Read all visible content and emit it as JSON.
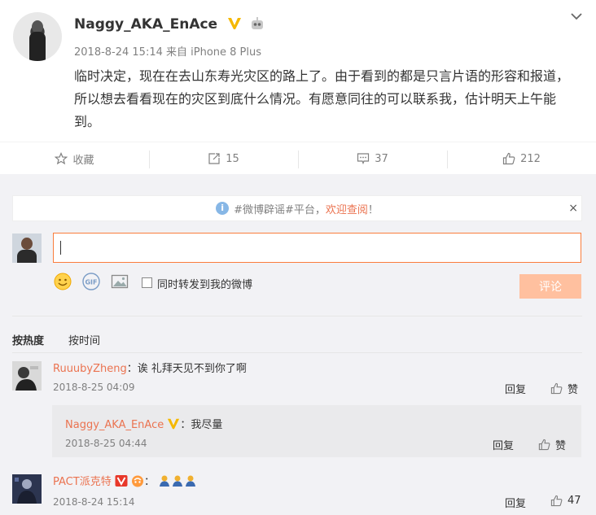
{
  "post": {
    "author": "Naggy_AKA_EnAce",
    "meta": "2018-8-24 15:14 来自 iPhone 8 Plus",
    "text": "临时决定，现在在去山东寿光灾区的路上了。由于看到的都是只言片语的形容和报道，所以想去看看现在的灾区到底什么情况。有愿意同往的可以联系我，估计明天上午能到。"
  },
  "actions": {
    "favorite": "收藏",
    "repost_count": "15",
    "comment_count": "37",
    "like_count": "212"
  },
  "notice": {
    "prefix": "#微博辟谣#平台，",
    "link": "欢迎查阅",
    "suffix": "！",
    "close": "×"
  },
  "composer": {
    "value": "",
    "repost_label": "同时转发到我的微博",
    "submit_label": "评论"
  },
  "sort": {
    "hot": "按热度",
    "time": "按时间"
  },
  "comments": [
    {
      "user": "RuuubyZheng",
      "text": "：诶 礼拜天见不到你了啊",
      "date": "2018-8-25 04:09",
      "reply_label": "回复",
      "like_label": "赞",
      "reply": {
        "user": "Naggy_AKA_EnAce",
        "text": "：我尽量",
        "date": "2018-8-25 04:44",
        "reply_label": "回复",
        "like_label": "赞"
      }
    },
    {
      "user": "PACT派克特",
      "text": "：",
      "date": "2018-8-24 15:14",
      "reply_label": "回复",
      "like_label": "47"
    }
  ],
  "colors": {
    "accent": "#eb7350",
    "input_border": "#fa7d3c",
    "submit_bg": "#ffc09f",
    "comments_bg": "#f2f2f5"
  }
}
